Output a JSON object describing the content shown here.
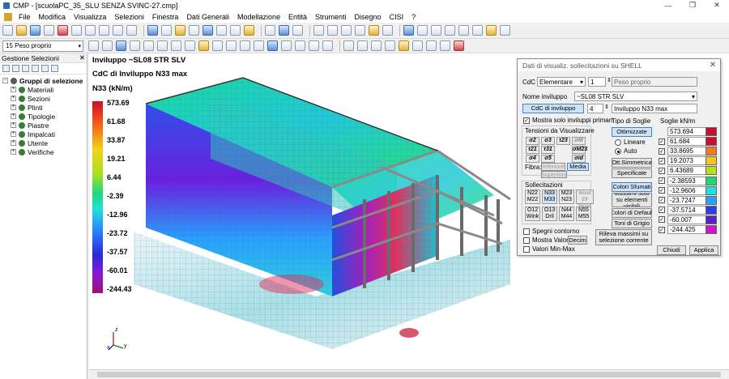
{
  "window": {
    "title": "CMP - [scuolaPC_35_SLU SENZA SVINC-27.cmp]"
  },
  "menu": [
    "File",
    "Modifica",
    "Visualizza",
    "Selezioni",
    "Finestra",
    "Dati Generali",
    "Modellazione",
    "Entità",
    "Strumenti",
    "Disegno",
    "CISI",
    "?"
  ],
  "load_case": {
    "selected": "15 Peso proprio"
  },
  "left_panel": {
    "title": "Gestione Selezioni",
    "root": "Gruppi di selezione",
    "items": [
      "Materiali",
      "Sezioni",
      "Plinti",
      "Tipologie",
      "Piastre",
      "Impalcati",
      "Utente",
      "Verifiche"
    ]
  },
  "viewport": {
    "line1": "Inviluppo ~SL08 STR SLV",
    "line2": "CdC di Inviluppo N33 max",
    "line3": "N33 (kN/m)",
    "legend": [
      "573.69",
      "61.68",
      "33.87",
      "19.21",
      "6.44",
      "-2.39",
      "-12.96",
      "-23.72",
      "-37.57",
      "-60.01",
      "-244.43"
    ],
    "axis_x": "x",
    "axis_y": "y",
    "axis_z": "z"
  },
  "dialog": {
    "title": "Dati di visualiz. sollecitazioni su SHELL",
    "cdc_label": "CdC",
    "cdc_type": "Elementare",
    "cdc_num": "1",
    "cdc_name": "Peso proprio",
    "inv_label": "Nome inviluppo",
    "inv_name": "~SL08 STR SLV",
    "cdc_inv_btn": "CdC di inviluppo",
    "cdc_inv_num": "4",
    "cdc_inv_name": "Inviluppo N33 max",
    "show_primary": "Mostra solo inviluppi primari",
    "tensioni_title": "Tensioni da Visualizzare",
    "tensioni": [
      "σ2",
      "σ3",
      "τ23",
      "σM",
      "τ21",
      "τ31",
      "σM23",
      "σ4",
      "σ5",
      "σid"
    ],
    "fibra_label": "Fibra:",
    "fibra": [
      "Inferiore",
      "Media",
      "Superiore"
    ],
    "soll_title": "Sollecitazioni",
    "soll": [
      "N22\nM22",
      "N33\nM33",
      "M23\nN23",
      "Wood Eff\nWood Int",
      "O12\nWink",
      "O13\nDril",
      "N44\nM44",
      "N55\nM55"
    ],
    "soglie_type_title": "Tipo di Soglie",
    "ottimizzate": "Ottimizzate",
    "lineare": "Lineare",
    "auto": "Auto",
    "ott_simm": "Ott.Simmetrica",
    "specificate": "Specificate",
    "colori_sfumati": "Colori Sfumati",
    "massimi": "Massimi solo su elementi visibili",
    "colori_default": "Colori di Default",
    "toni_grigio": "Toni di Grigio",
    "soglie_title": "Soglie kN/m",
    "soglie": [
      "573.694",
      "61.684",
      "33.8695",
      "19.2073",
      "6.43689",
      "-2.38593",
      "-12.9606",
      "-23.7247",
      "-37.5714",
      "-60.007",
      "-244.425"
    ],
    "soglie_colors": [
      "#c8102e",
      "#c8102e",
      "#f07820",
      "#f5c518",
      "#b8e020",
      "#20d870",
      "#20e0e0",
      "#28a0ff",
      "#2a40e0",
      "#5a20c8",
      "#c818c8"
    ],
    "spegni": "Spegni contorno",
    "mostra_valori": "Mostra Valori",
    "decim": "Decim",
    "valori_minmax": "Valori Min-Max",
    "rileva": "Rileva massimi su selezione corrente",
    "chiudi": "Chiudi",
    "applica": "Applica"
  }
}
